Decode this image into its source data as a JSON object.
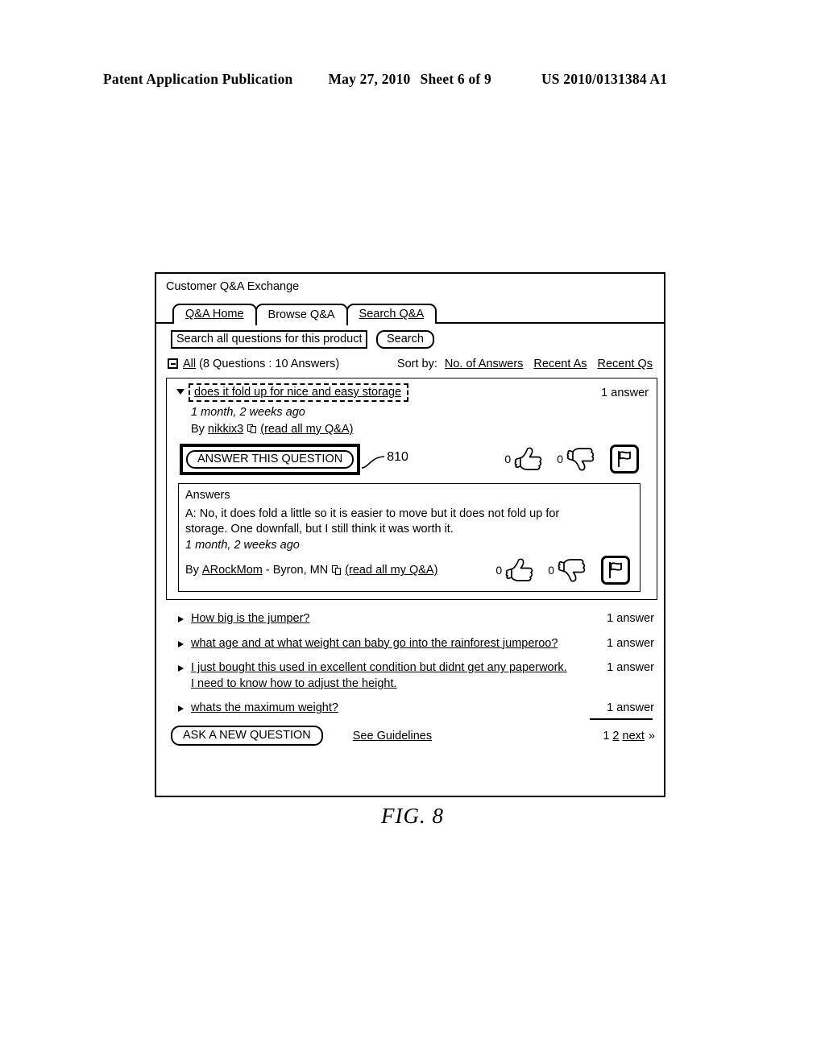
{
  "patent_header": {
    "publication": "Patent Application Publication",
    "date": "May 27, 2010",
    "sheet": "Sheet 6 of 9",
    "number": "US 2010/0131384 A1"
  },
  "figure": {
    "caption": "FIG. 8",
    "callout": "810"
  },
  "panel": {
    "title": "Customer Q&A Exchange",
    "tabs": [
      {
        "label": "Q&A Home",
        "active": false
      },
      {
        "label": "Browse Q&A",
        "active": true
      },
      {
        "label": "Search Q&A",
        "active": false
      }
    ],
    "search": {
      "placeholder": "Search all questions for this product",
      "value": "",
      "button_label": "Search"
    },
    "summary": {
      "all_label": "All",
      "counts": "(8 Questions : 10 Answers)",
      "collapse_icon": "minus-box-icon"
    },
    "sort": {
      "label": "Sort by:",
      "options": [
        "No. of Answers",
        "Recent As",
        "Recent Qs"
      ]
    },
    "expanded_question": {
      "toggle_icon": "triangle-down-icon",
      "text": "does it fold up for nice and easy storage",
      "answer_count": "1 answer",
      "timestamp": "1 month, 2 weeks ago",
      "by_prefix": "By",
      "author": "nikkix3",
      "author_icon": "pages-icon",
      "read_all_link": "(read all my Q&A)",
      "answer_button": "ANSWER THIS QUESTION",
      "votes": {
        "up_count": "0",
        "up_icon": "thumbs-up-icon",
        "down_count": "0",
        "down_icon": "thumbs-down-icon",
        "flag_icon": "flag-icon"
      }
    },
    "answers_section": {
      "title": "Answers",
      "body": "A: No, it does fold a little so it is easier to move but it does not fold up for storage. One downfall, but I still think it was worth it.",
      "timestamp": "1 month, 2 weeks ago",
      "by_prefix": "By",
      "author": "ARockMom",
      "location": "- Byron, MN",
      "author_icon": "pages-icon",
      "read_all_link": "(read all my Q&A)",
      "votes": {
        "up_count": "0",
        "up_icon": "thumbs-up-icon",
        "down_count": "0",
        "down_icon": "thumbs-down-icon",
        "flag_icon": "flag-icon"
      }
    },
    "question_list": [
      {
        "text": "How big is the jumper?",
        "answers": "1 answer"
      },
      {
        "text": "what age and at what weight can baby go into the rainforest jumperoo?",
        "answers": "1 answer"
      },
      {
        "text": "I just bought this used in excellent condition but didnt get any paperwork. I need to know how to adjust the height.",
        "answers": "1 answer"
      },
      {
        "text": "whats the maximum weight?",
        "answers": "1 answer"
      }
    ],
    "footer": {
      "ask_button": "ASK A NEW QUESTION",
      "guidelines_link": "See Guidelines",
      "pagination": {
        "current": "1",
        "next_page": "2",
        "next_label": "next",
        "chevron": "»"
      }
    }
  },
  "colors": {
    "ink": "#000000",
    "paper": "#ffffff"
  }
}
